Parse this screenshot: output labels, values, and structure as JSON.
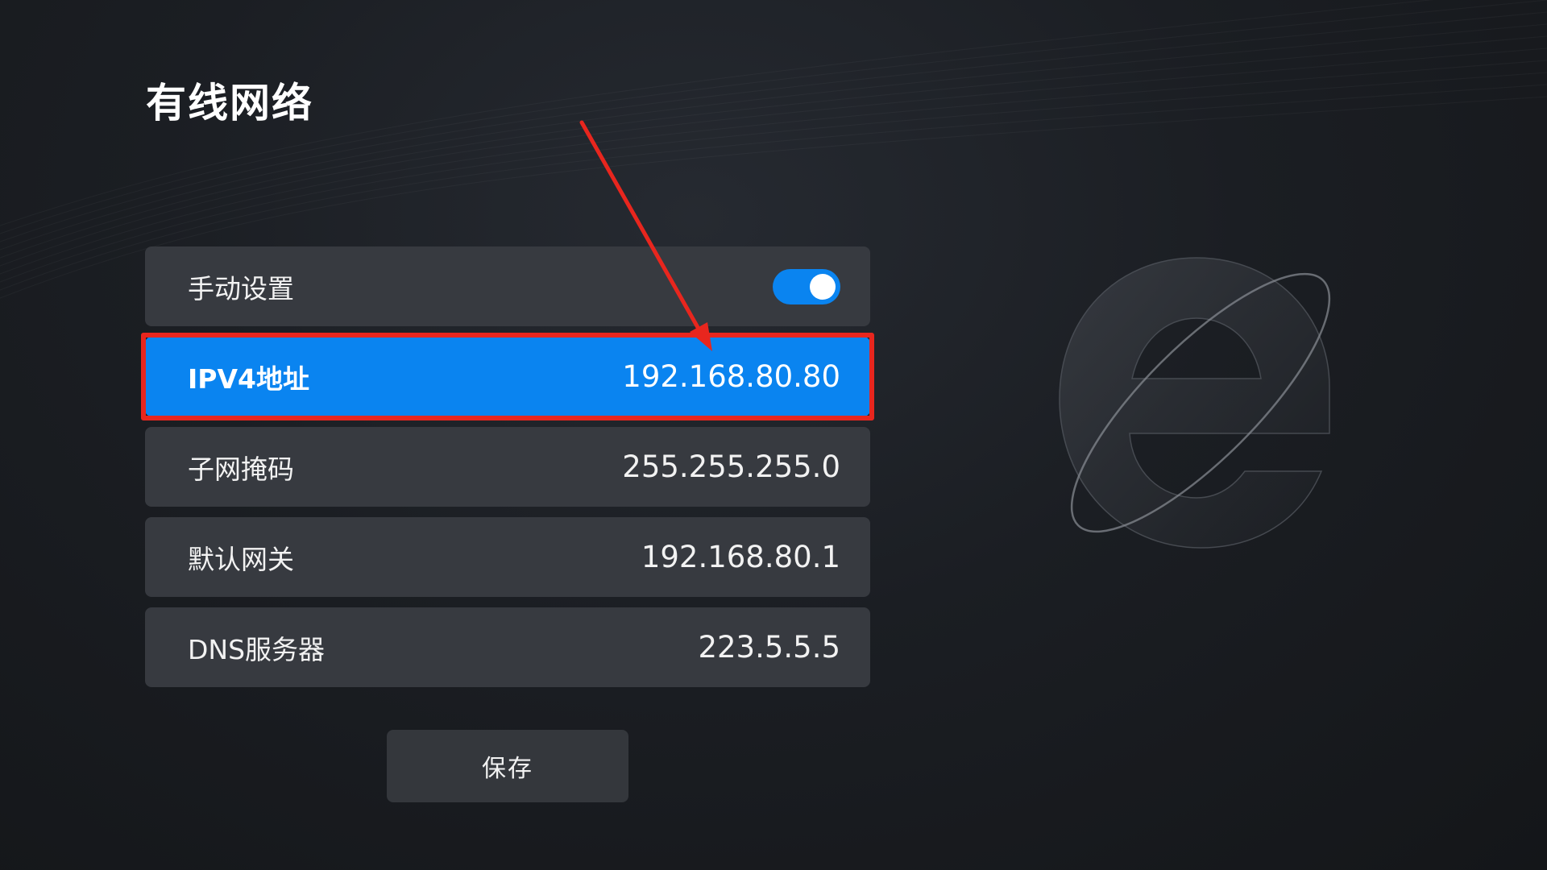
{
  "title": "有线网络",
  "settings": {
    "manual": {
      "label": "手动设置",
      "enabled": true
    },
    "ipv4": {
      "label": "IPV4地址",
      "value": "192.168.80.80"
    },
    "subnet": {
      "label": "子网掩码",
      "value": "255.255.255.0"
    },
    "gateway": {
      "label": "默认网关",
      "value": "192.168.80.1"
    },
    "dns": {
      "label": "DNS服务器",
      "value": "223.5.5.5"
    }
  },
  "save_label": "保存",
  "colors": {
    "accent": "#0a84f0",
    "row_background": "#373a40",
    "annotation_red": "#e8261e"
  },
  "icons": {
    "logo": "browser-e-logo-icon",
    "annotation": "red-arrow-icon"
  }
}
